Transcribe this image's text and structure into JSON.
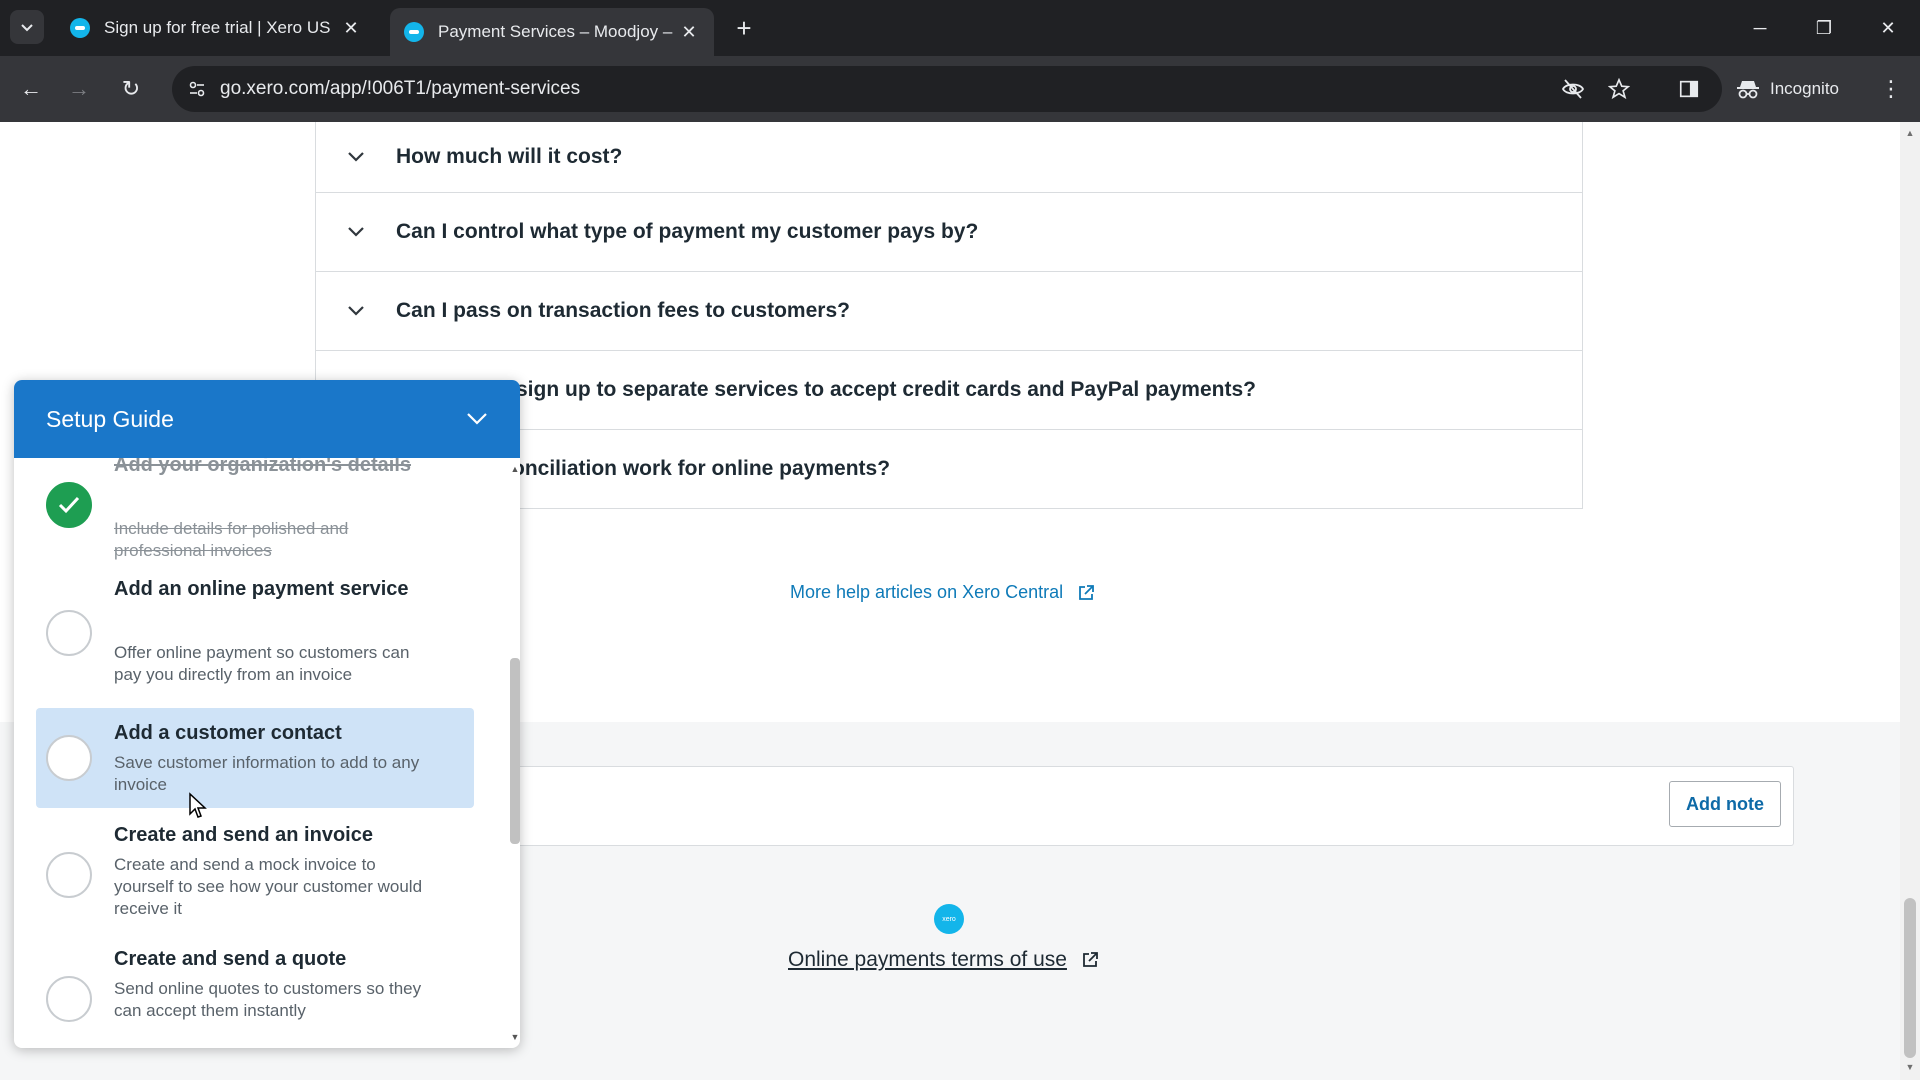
{
  "browser": {
    "tabs": [
      {
        "title": "Sign up for free trial | Xero US",
        "active": false
      },
      {
        "title": "Payment Services – Moodjoy –",
        "active": true
      }
    ],
    "url": "go.xero.com/app/!006T1/payment-services",
    "incognito_label": "Incognito"
  },
  "faq": {
    "items": [
      {
        "question": "How much will it cost?"
      },
      {
        "question": "Can I control what type of payment my customer pays by?"
      },
      {
        "question": "Can I pass on transaction fees to customers?"
      },
      {
        "question": "sign up to separate services to accept credit cards and PayPal payments?"
      },
      {
        "question": "onciliation work for online payments?"
      }
    ],
    "help_link": "More help articles on Xero Central"
  },
  "notes": {
    "add_note_label": "Add note"
  },
  "footer": {
    "logo_text": "xero",
    "terms_link": "Online payments terms of use"
  },
  "setup_guide": {
    "title": "Setup Guide",
    "steps": [
      {
        "title": "Add your organization's details",
        "desc": "Include details for polished and professional invoices",
        "done": true
      },
      {
        "title": "Add an online payment service",
        "desc": "Offer online payment so customers can pay you directly from an invoice",
        "done": false
      },
      {
        "title": "Add a customer contact",
        "desc": "Save customer information to add to any invoice",
        "done": false,
        "highlighted": true
      },
      {
        "title": "Create and send an invoice",
        "desc": "Create and send a mock invoice to yourself to see how your customer would receive it",
        "done": false
      },
      {
        "title": "Create and send a quote",
        "desc": "Send online quotes to customers so they can accept them instantly",
        "done": false
      }
    ]
  },
  "colors": {
    "guide_header": "#1a77c9",
    "done_green": "#1e9e52",
    "link_blue": "#0e7ab8",
    "highlight": "#cfe3f7"
  }
}
